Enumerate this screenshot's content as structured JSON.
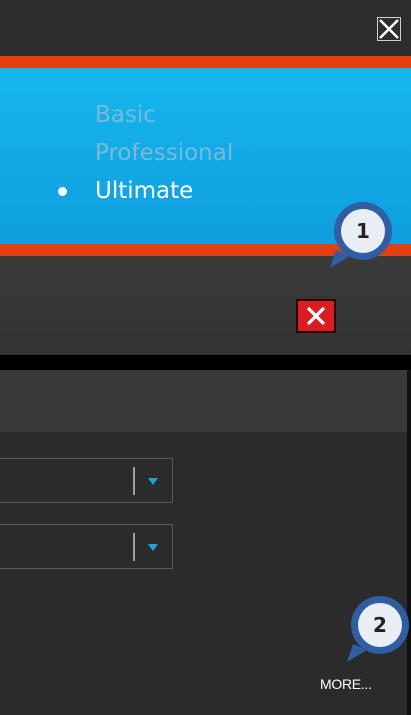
{
  "window": {
    "close_icon": "close-x-icon"
  },
  "editions": {
    "items": [
      {
        "label": "Basic",
        "selected": false
      },
      {
        "label": "Professional",
        "selected": false
      },
      {
        "label": "Ultimate",
        "selected": true
      }
    ]
  },
  "toolbar": {
    "close_icon": "red-close-icon"
  },
  "dropdowns": [
    {
      "value": "",
      "arrow_icon": "chevron-down-icon"
    },
    {
      "value": "",
      "arrow_icon": "chevron-down-icon"
    }
  ],
  "more_link": {
    "label": "MORE..."
  },
  "callouts": [
    {
      "number": "1"
    },
    {
      "number": "2"
    }
  ],
  "colors": {
    "accent_orange": "#e2400e",
    "banner_blue": "#16b7ef",
    "close_red": "#d81d23",
    "dropdown_arrow": "#1aa3e0",
    "callout_ring": "#2f5ea3",
    "callout_fill": "#e9eef5"
  }
}
